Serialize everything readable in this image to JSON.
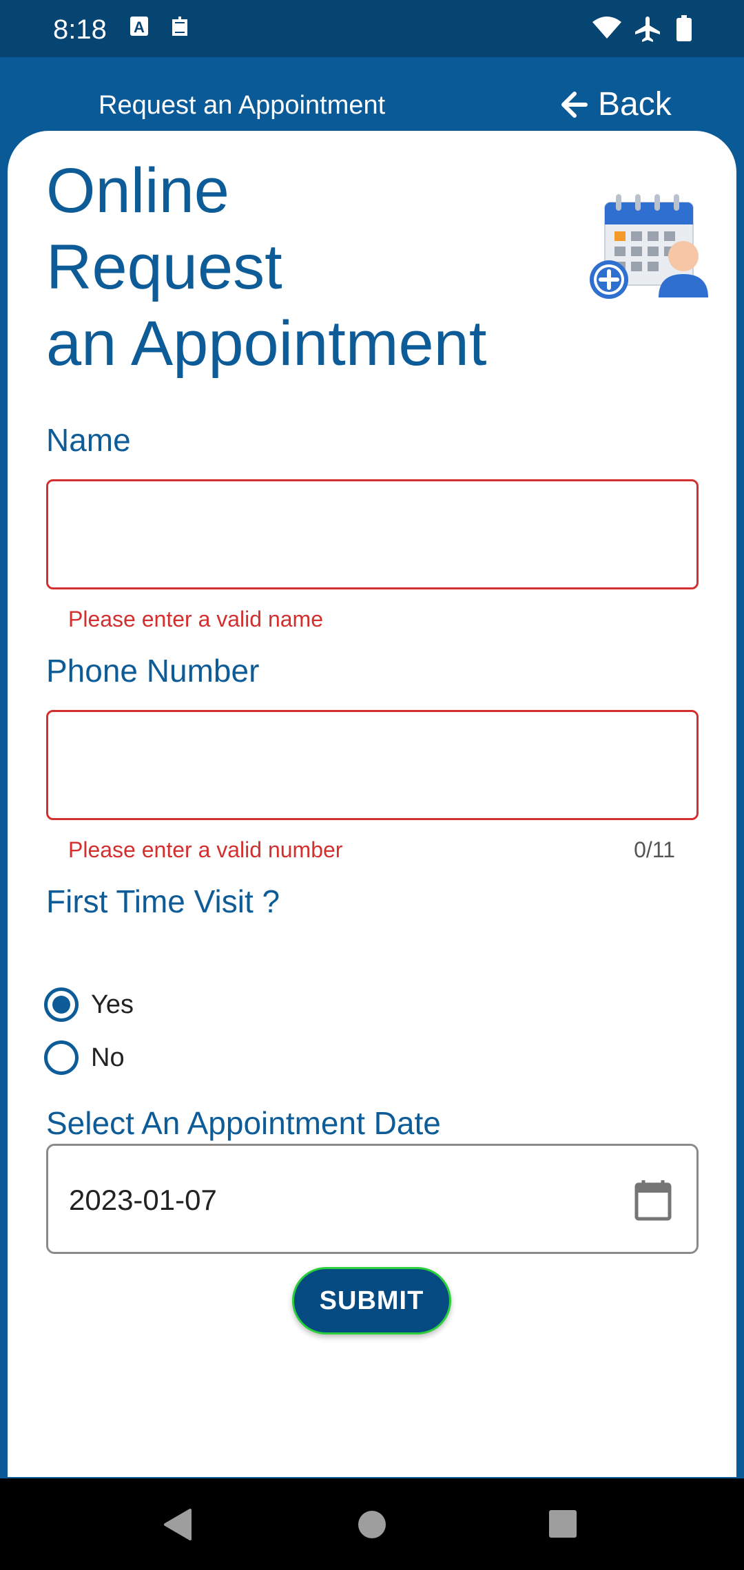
{
  "status_bar": {
    "time": "8:18",
    "left_icons": [
      "font-a-icon",
      "robot-icon"
    ],
    "right_icons": [
      "wifi-icon",
      "airplane-icon",
      "battery-icon"
    ]
  },
  "app_bar": {
    "title": "Request an Appointment",
    "back_label": "Back",
    "background_color": "#0a5a97"
  },
  "headline": {
    "line1": "Online",
    "line2": "Request",
    "line3": "an Appointment",
    "illustration": "calendar-add-user-icon"
  },
  "form": {
    "name": {
      "label": "Name",
      "value": "",
      "error": "Please enter a valid name"
    },
    "phone": {
      "label": "Phone Number",
      "value": "",
      "error": "Please enter a valid number",
      "counter": "0/11"
    },
    "first_visit": {
      "label": "First Time Visit ?",
      "options": [
        {
          "label": "Yes",
          "checked": true
        },
        {
          "label": "No",
          "checked": false
        }
      ]
    },
    "date": {
      "label": "Select An Appointment Date",
      "value": "2023-01-07"
    },
    "submit_label": "SUBMIT"
  },
  "colors": {
    "primary": "#0d5c98",
    "error": "#d32f2f",
    "submit_border": "#2bcf3c",
    "status_bar": "#064471"
  },
  "nav_bar": {
    "buttons": [
      "back-triangle-icon",
      "home-circle-icon",
      "recents-square-icon"
    ]
  }
}
